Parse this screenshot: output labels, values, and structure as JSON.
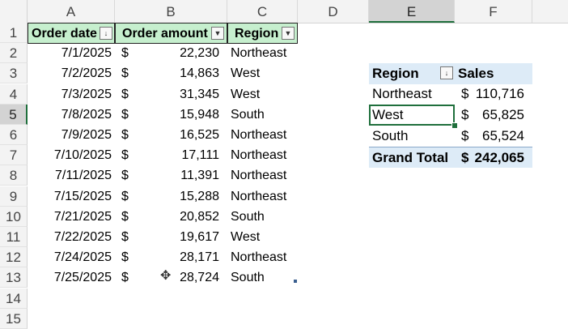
{
  "columns": [
    "A",
    "B",
    "C",
    "D",
    "E",
    "F"
  ],
  "rows": [
    "1",
    "2",
    "3",
    "4",
    "5",
    "6",
    "7",
    "8",
    "9",
    "10",
    "11",
    "12",
    "13",
    "14",
    "15"
  ],
  "table": {
    "headers": [
      "Order date",
      "Order amount",
      "Region"
    ],
    "dropdown_glyph": "▼",
    "sort_glyph": "↓",
    "currency": "$",
    "data": [
      {
        "date": "7/1/2025",
        "amount": "22,230",
        "region": "Northeast"
      },
      {
        "date": "7/2/2025",
        "amount": "14,863",
        "region": "West"
      },
      {
        "date": "7/3/2025",
        "amount": "31,345",
        "region": "West"
      },
      {
        "date": "7/8/2025",
        "amount": "15,948",
        "region": "South"
      },
      {
        "date": "7/9/2025",
        "amount": "16,525",
        "region": "Northeast"
      },
      {
        "date": "7/10/2025",
        "amount": "17,111",
        "region": "Northeast"
      },
      {
        "date": "7/11/2025",
        "amount": "11,391",
        "region": "Northeast"
      },
      {
        "date": "7/15/2025",
        "amount": "15,288",
        "region": "Northeast"
      },
      {
        "date": "7/21/2025",
        "amount": "20,852",
        "region": "South"
      },
      {
        "date": "7/22/2025",
        "amount": "19,617",
        "region": "West"
      },
      {
        "date": "7/24/2025",
        "amount": "28,171",
        "region": "Northeast"
      },
      {
        "date": "7/25/2025",
        "amount": "28,724",
        "region": "South"
      }
    ]
  },
  "pivot": {
    "header_label": "Region",
    "value_label": "Sales",
    "rows": [
      {
        "label": "Northeast",
        "currency": "$",
        "value": "110,716"
      },
      {
        "label": "West",
        "currency": "$",
        "value": "65,825"
      },
      {
        "label": "South",
        "currency": "$",
        "value": "65,524"
      }
    ],
    "total": {
      "label": "Grand Total",
      "currency": "$",
      "value": "242,065"
    }
  },
  "selection": {
    "column": "E",
    "row": "5"
  },
  "cursor_glyph": "✥"
}
